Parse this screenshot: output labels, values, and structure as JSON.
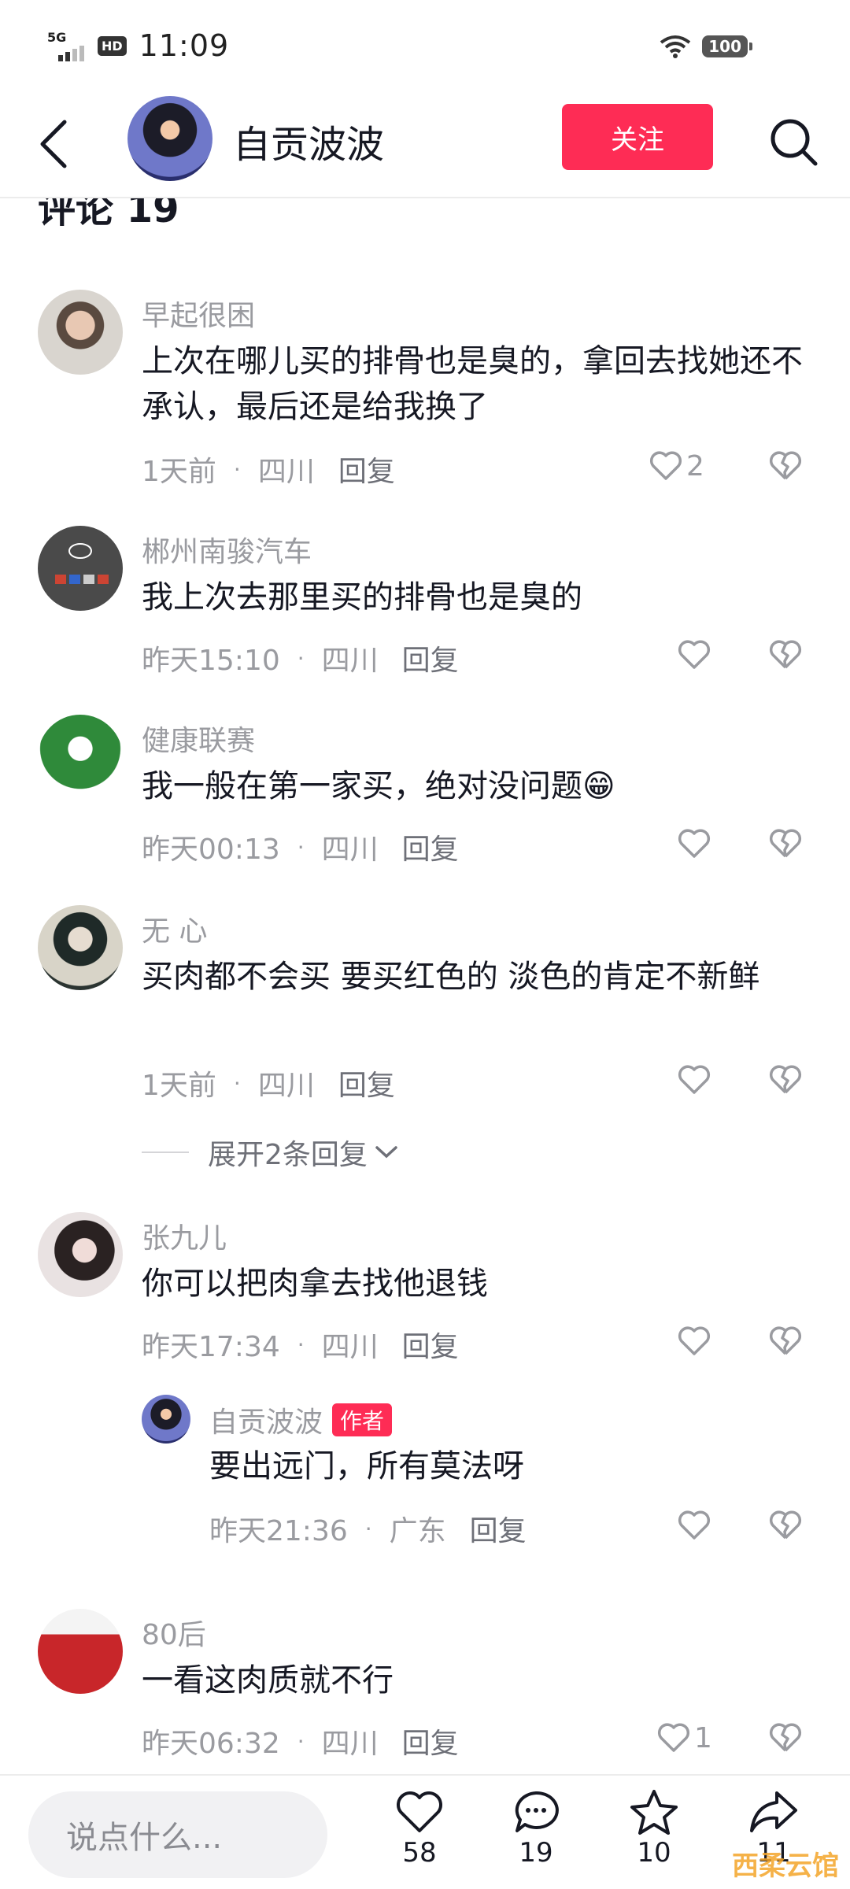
{
  "status_bar": {
    "network": "5G",
    "hd": "HD",
    "time": "11:09",
    "battery": "100"
  },
  "header": {
    "back_icon": "chevron-left-icon",
    "user_name": "自贡波波",
    "follow_label": "关注",
    "search_icon": "search-icon"
  },
  "section_title": "评论 19",
  "comments": [
    {
      "name": "早起很困",
      "text": "上次在哪儿买的排骨也是臭的，拿回去找她还不承认，最后还是给我换了",
      "time": "1天前",
      "location": "四川",
      "reply": "回复",
      "likes": "2"
    },
    {
      "name": "郴州南骏汽车",
      "text": "我上次去那里买的排骨也是臭的",
      "time": "昨天15:10",
      "location": "四川",
      "reply": "回复",
      "likes": ""
    },
    {
      "name": "健康联赛",
      "text": "我一般在第一家买，绝对没问题😁",
      "time": "昨天00:13",
      "location": "四川",
      "reply": "回复",
      "likes": ""
    },
    {
      "name": "无  心",
      "text": "买肉都不会买 要买红色的 淡色的肯定不新鲜",
      "time": "1天前",
      "location": "四川",
      "reply": "回复",
      "likes": ""
    },
    {
      "name": "张九儿",
      "text": "你可以把肉拿去找他退钱",
      "time": "昨天17:34",
      "location": "四川",
      "reply": "回复",
      "likes": ""
    },
    {
      "name": "80后",
      "text": "一看这肉质就不行",
      "time": "昨天06:32",
      "location": "四川",
      "reply": "回复",
      "likes": "1"
    }
  ],
  "expand_replies": "展开2条回复",
  "author_reply": {
    "name": "自贡波波",
    "badge": "作者",
    "text": "要出远门，所有莫法呀",
    "time": "昨天21:36",
    "location": "广东",
    "reply": "回复"
  },
  "bottom_bar": {
    "input_placeholder": "说点什么...",
    "likes": "58",
    "comments": "19",
    "favorites": "10",
    "shares": "11"
  },
  "watermark": "西柔云馆",
  "colors": {
    "accent": "#fe2c55",
    "muted": "#9a9ba0",
    "text": "#161823"
  }
}
